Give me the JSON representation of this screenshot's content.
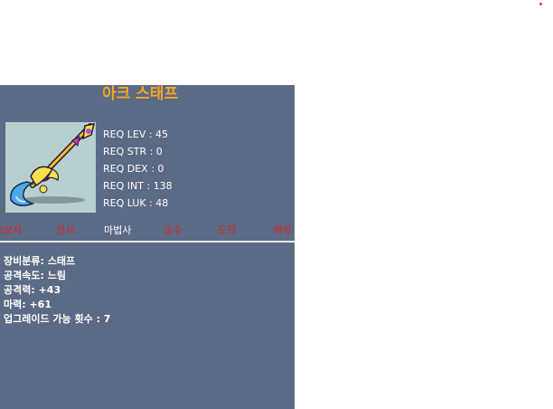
{
  "item": {
    "name": "아크 스태프",
    "requirements": [
      "REQ LEV : 45",
      "REQ STR : 0",
      "REQ DEX : 0",
      "REQ INT : 138",
      "REQ LUK : 48"
    ],
    "jobs": [
      {
        "label": "초보자",
        "color": "#e02020"
      },
      {
        "label": "전사",
        "color": "#e02020"
      },
      {
        "label": "마법사",
        "color": "#ffffff"
      },
      {
        "label": "궁수",
        "color": "#e02020"
      },
      {
        "label": "도적",
        "color": "#e02020"
      },
      {
        "label": "해적",
        "color": "#e02020"
      }
    ],
    "stats": [
      "장비분류: 스태프",
      "공격속도: 느림",
      "공격력: +43",
      "마력: +61",
      "업그레이드 가능 횟수 : 7"
    ]
  },
  "colors": {
    "panel": "#5b6a85",
    "title": "#f5a623",
    "unavailable_job": "#e02020",
    "available_job": "#ffffff"
  }
}
